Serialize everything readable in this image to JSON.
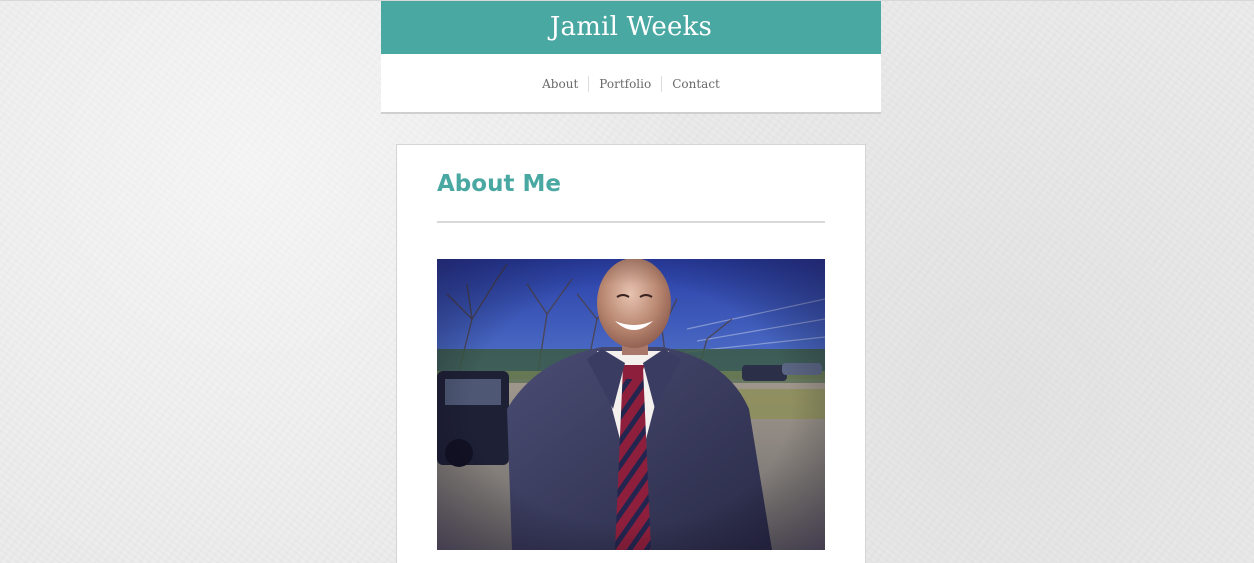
{
  "header": {
    "title": "Jamil Weeks",
    "accent_color": "#4aa8a2"
  },
  "nav": {
    "items": [
      {
        "label": "About"
      },
      {
        "label": "Portfolio"
      },
      {
        "label": "Contact"
      }
    ]
  },
  "about": {
    "heading": "About Me",
    "photo": "portrait-photo"
  }
}
